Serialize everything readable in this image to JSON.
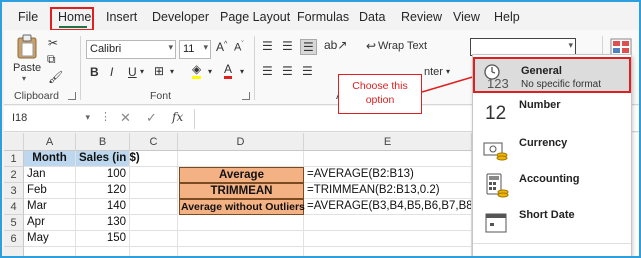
{
  "menu": {
    "items": [
      "File",
      "Home",
      "Insert",
      "Developer",
      "Page Layout",
      "Formulas",
      "Data",
      "Review",
      "View",
      "Help"
    ],
    "active": "Home"
  },
  "ribbon": {
    "clipboard": {
      "paste_label": "Paste",
      "group_label": "Clipboard"
    },
    "font": {
      "font_name": "Calibri",
      "font_size": "11",
      "group_label": "Font",
      "bold": "B",
      "italic": "I",
      "underline": "U"
    },
    "alignment": {
      "wrap_text": "Wrap Text",
      "merge_partial": "nter",
      "group_label": "A"
    },
    "number": {
      "format_value": ""
    }
  },
  "formula_bar": {
    "name_box": "I18",
    "fx": "fx",
    "content": ""
  },
  "grid": {
    "columns": [
      "A",
      "B",
      "C",
      "D",
      "E"
    ],
    "rows": [
      "1",
      "2",
      "3",
      "4",
      "5",
      "6"
    ],
    "table": {
      "headers": [
        "Month",
        "Sales (in $)"
      ],
      "rows": [
        [
          "Jan",
          "100"
        ],
        [
          "Feb",
          "120"
        ],
        [
          "Mar",
          "140"
        ],
        [
          "Apr",
          "130"
        ],
        [
          "May",
          "150"
        ]
      ]
    },
    "labels": [
      "Average",
      "TRIMMEAN",
      "Average without Outliers"
    ],
    "formulas": [
      "=AVERAGE(B2:B13)",
      "=TRIMMEAN(B2:B13,0.2)",
      "=AVERAGE(B3,B4,B5,B6,B7,B8,B9,B10"
    ]
  },
  "callout": {
    "text": "Choose this option"
  },
  "number_format_dropdown": {
    "items": [
      {
        "title": "General",
        "subtitle": "No specific format",
        "icon": "123"
      },
      {
        "title": "Number",
        "subtitle": "",
        "icon": "12"
      },
      {
        "title": "Currency",
        "subtitle": "",
        "icon": "currency-icon"
      },
      {
        "title": "Accounting",
        "subtitle": "",
        "icon": "calculator-icon"
      },
      {
        "title": "Short Date",
        "subtitle": "",
        "icon": "calendar-icon"
      }
    ],
    "selected": "General"
  },
  "colors": {
    "highlight_red": "#e02020",
    "header_blue": "#bdd7ee",
    "label_orange": "#f4b183",
    "excel_green": "#217346"
  }
}
